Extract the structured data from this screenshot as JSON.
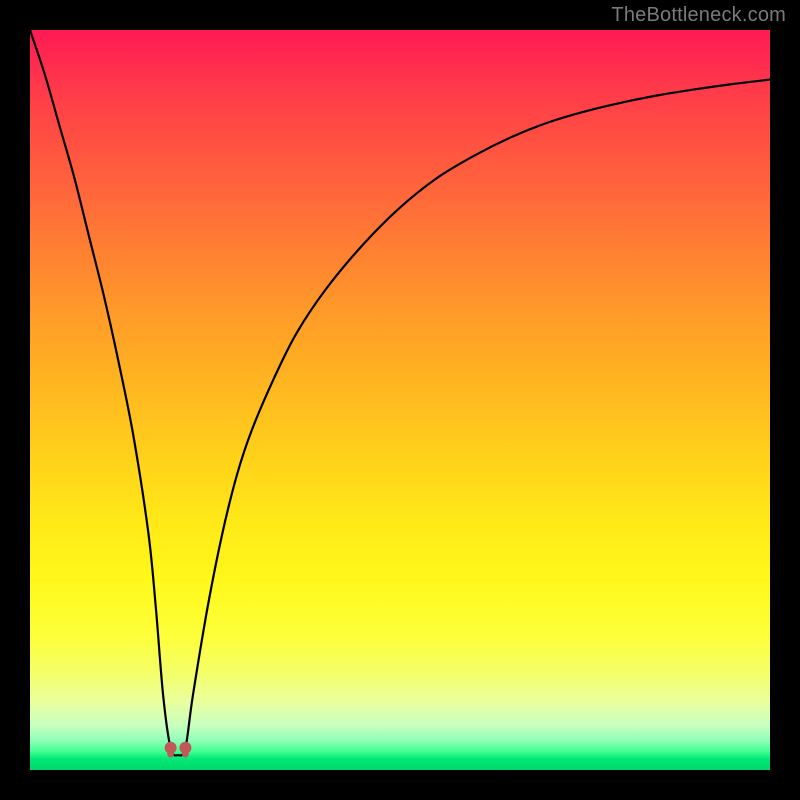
{
  "watermark": {
    "text": "TheBottleneck.com"
  },
  "chart_data": {
    "type": "line",
    "title": "",
    "xlabel": "",
    "ylabel": "",
    "xlim": [
      0,
      100
    ],
    "ylim": [
      0,
      100
    ],
    "series": [
      {
        "name": "bottleneck-curve",
        "x": [
          0,
          2,
          4,
          6,
          8,
          10,
          12,
          14,
          16,
          17,
          18,
          19,
          20,
          21,
          22,
          24,
          26,
          28,
          30,
          33,
          36,
          40,
          45,
          50,
          55,
          60,
          65,
          70,
          75,
          80,
          85,
          90,
          95,
          100
        ],
        "values": [
          100,
          94,
          87,
          80,
          72,
          64,
          55,
          45,
          32,
          22,
          10,
          3,
          2,
          3,
          10,
          22,
          32,
          40,
          46,
          53,
          59,
          65,
          71,
          76,
          80,
          83,
          85.5,
          87.5,
          89,
          90.2,
          91.2,
          92,
          92.7,
          93.3
        ]
      }
    ],
    "markers": [
      {
        "name": "min-marker-left",
        "x": 19.0,
        "y": 3,
        "color": "#c15a56",
        "size": 12
      },
      {
        "name": "min-marker-right",
        "x": 21.0,
        "y": 3,
        "color": "#c15a56",
        "size": 12
      }
    ],
    "gradient_stops": [
      {
        "pos": 0,
        "color": "#ff1a55"
      },
      {
        "pos": 0.5,
        "color": "#ffd21a"
      },
      {
        "pos": 0.95,
        "color": "#90ffb8"
      },
      {
        "pos": 1.0,
        "color": "#00d868"
      }
    ]
  }
}
